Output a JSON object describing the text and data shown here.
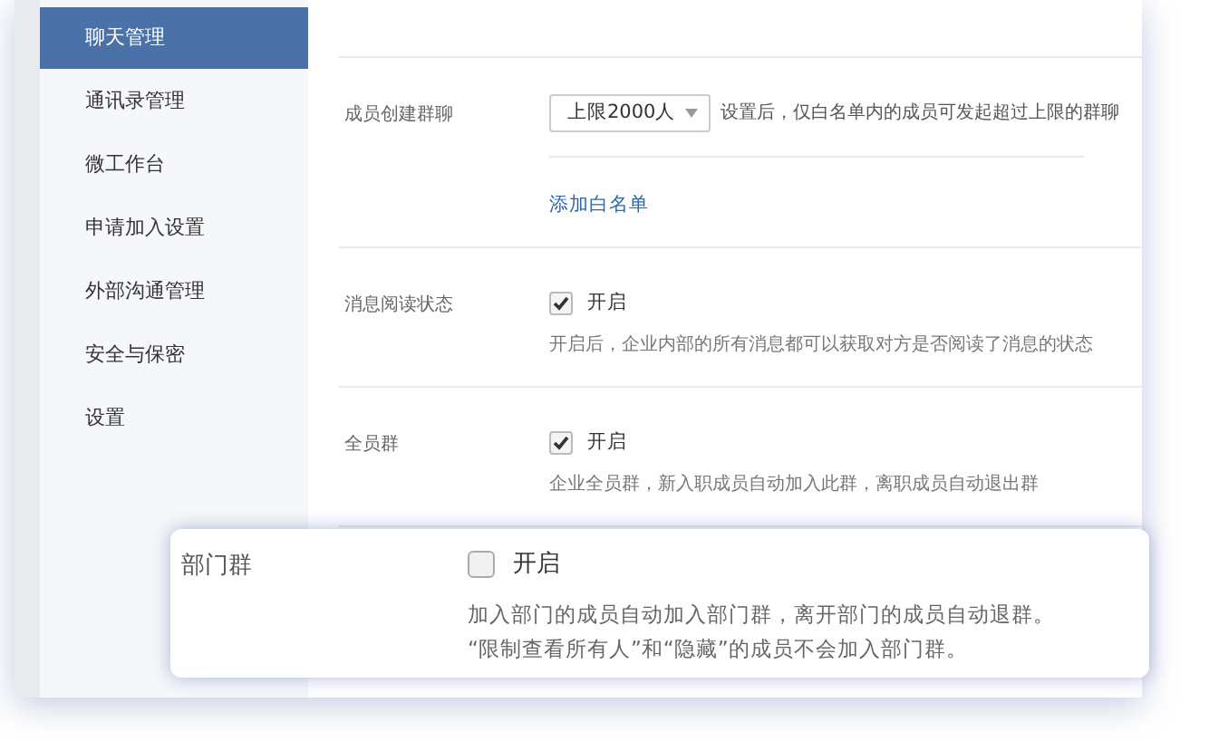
{
  "sidebar": {
    "items": [
      {
        "label": "聊天管理",
        "selected": true
      },
      {
        "label": "通讯录管理",
        "selected": false
      },
      {
        "label": "微工作台",
        "selected": false
      },
      {
        "label": "申请加入设置",
        "selected": false
      },
      {
        "label": "外部沟通管理",
        "selected": false
      },
      {
        "label": "安全与保密",
        "selected": false
      },
      {
        "label": "设置",
        "selected": false
      }
    ]
  },
  "settings": [
    {
      "kind": "select",
      "label": "成员创建群聊",
      "value": "上限2000人",
      "note": "设置后，仅白名单内的成员可发起超过上限的群聊",
      "link": "添加白名单"
    },
    {
      "kind": "checkbox",
      "label": "消息阅读状态",
      "checked": true,
      "option": "开启",
      "description": "开启后，企业内部的所有消息都可以获取对方是否阅读了消息的状态"
    },
    {
      "kind": "checkbox",
      "label": "全员群",
      "checked": true,
      "option": "开启",
      "description": "企业全员群，新入职成员自动加入此群，离职成员自动退出群"
    }
  ],
  "popup": {
    "label": "部门群",
    "checked": false,
    "option": "开启",
    "description_lines": [
      "加入部门的成员自动加入部门群，离开部门的成员自动退群。",
      "“限制查看所有人”和“隐藏”的成员不会加入部门群。"
    ]
  }
}
